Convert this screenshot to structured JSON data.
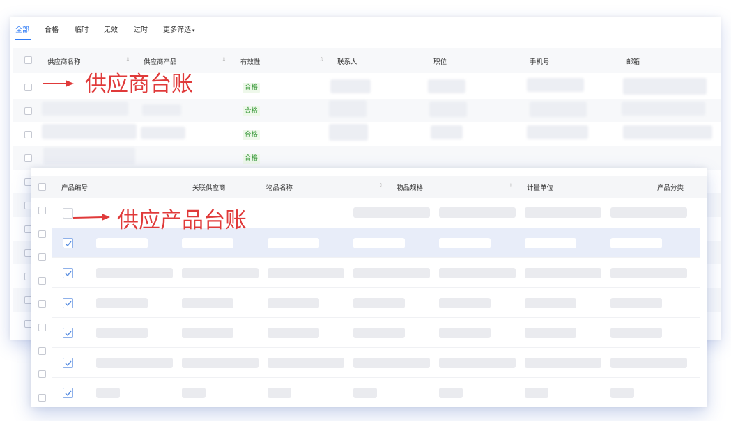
{
  "filters": {
    "tabs": [
      "全部",
      "合格",
      "临时",
      "无效",
      "过时"
    ],
    "more": "更多筛选",
    "active_index": 0,
    "accent": "#2f7bf5"
  },
  "supplier_table": {
    "columns": [
      "供应商名称",
      "供应商产品",
      "有效性",
      "联系人",
      "职位",
      "手机号",
      "邮箱"
    ],
    "rows": [
      {
        "validity": "合格"
      },
      {
        "validity": "合格"
      },
      {
        "validity": "合格"
      },
      {
        "validity": "合格"
      }
    ],
    "status_color": "#3a9a3a"
  },
  "product_table": {
    "columns": [
      "产品编号",
      "关联供应商",
      "物品名称",
      "物品规格",
      "计量单位",
      "产品分类"
    ]
  },
  "annotations": {
    "supplier_ledger": "供应商台账",
    "product_ledger": "供应产品台账",
    "color": "#e03a3a"
  }
}
